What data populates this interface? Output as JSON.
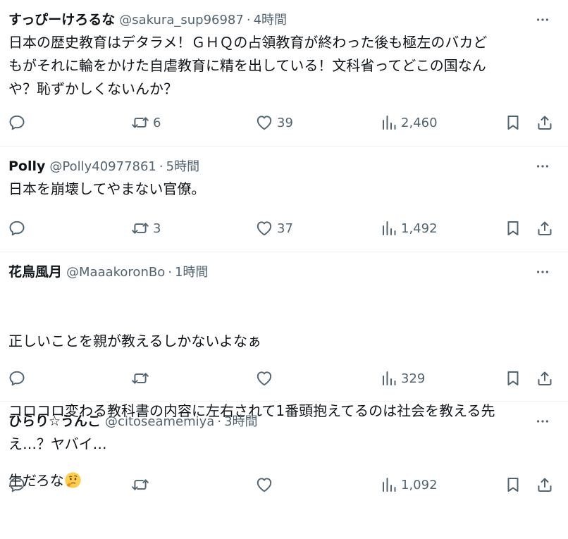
{
  "colors": {
    "text": "#0f1419",
    "secondary": "#536471",
    "divider": "#eff3f4"
  },
  "icons": {
    "reply": "speech-bubble-icon",
    "retweet": "retweet-arrows-icon",
    "like": "heart-icon",
    "views": "bar-chart-icon",
    "bookmark": "bookmark-icon",
    "share": "share-upload-icon",
    "more": "three-dots-icon"
  },
  "tweets": [
    {
      "display_name": "すっぴーけろるな",
      "handle": "@sakura_sup96987",
      "separator": "·",
      "time": "4時間",
      "text": "日本の歴史教育はデタラメ！ＧＨＱの占領教育が終わった後も極左のバカど\nもがそれに輪をかけた自虐教育に精を出している！文科省ってどこの国なん\nや？恥ずかしくないんか？",
      "replies": "",
      "retweets": "6",
      "likes": "39",
      "views": "2,460"
    },
    {
      "display_name": "Polly",
      "handle": "@Polly40977861",
      "separator": "·",
      "time": "5時間",
      "text": "日本を崩壊してやまない官僚。",
      "replies": "",
      "retweets": "3",
      "likes": "37",
      "views": "1,492"
    },
    {
      "display_name": "花鳥風月",
      "handle": "@MaaakoronBo",
      "separator": "·",
      "time": "1時間",
      "text_line1": "正しいことを親が教えるしかないよなぁ",
      "text_line2": "コロコロ変わる教科書の内容に左右されて1番頭抱えてるのは社会を教える先",
      "text_line3": "生だろな",
      "emoji": "thinking-face-emoji",
      "replies": "",
      "retweets": "",
      "likes": "",
      "views": "329"
    },
    {
      "display_name": "ひらり☆うんこ",
      "handle": "@citoseamemiya",
      "separator": "·",
      "time": "3時間",
      "text": "え…？ヤバイ…",
      "replies": "",
      "retweets": "",
      "likes": "",
      "views": "1,092"
    }
  ]
}
